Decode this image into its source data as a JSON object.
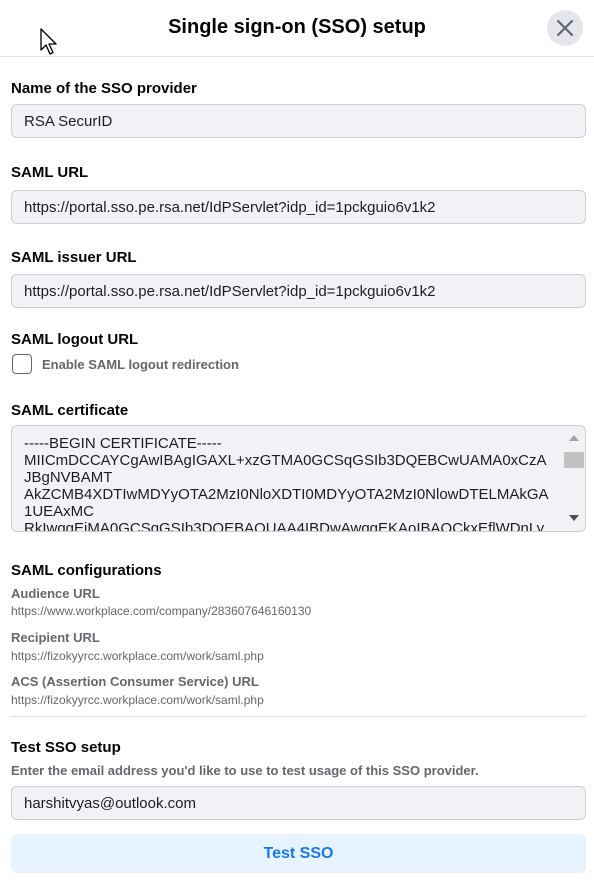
{
  "dialog": {
    "title": "Single sign-on (SSO) setup",
    "close_icon": "close-icon"
  },
  "provider": {
    "label": "Name of the SSO provider",
    "value": "RSA SecurID"
  },
  "saml_url": {
    "label": "SAML URL",
    "value": "https://portal.sso.pe.rsa.net/IdPServlet?idp_id=1pckguio6v1k2"
  },
  "saml_issuer_url": {
    "label": "SAML issuer URL",
    "value": "https://portal.sso.pe.rsa.net/IdPServlet?idp_id=1pckguio6v1k2"
  },
  "saml_logout": {
    "label": "SAML logout URL",
    "checkbox_label": "Enable SAML logout redirection",
    "checked": false
  },
  "certificate": {
    "label": "SAML certificate",
    "value": "-----BEGIN CERTIFICATE-----\nMIICmDCCAYCgAwIBAgIGAXL+xzGTMA0GCSqGSIb3DQEBCwUAMA0xCzA\nJBgNVBAMT\nAkZCMB4XDTIwMDYyOTA2MzI0NloXDTI0MDYyOTA2MzI0NlowDTELMAkGA\n1UEAxMC\nRkIwggEiMA0GCSqGSIb3DQEBAQUAA4IBDwAwggEKAoIBAQCkxEflWDnLy"
  },
  "saml_config": {
    "label": "SAML configurations",
    "audience_label": "Audience URL",
    "audience_value": "https://www.workplace.com/company/283607646160130",
    "recipient_label": "Recipient URL",
    "recipient_value": "https://fizokyyrcc.workplace.com/work/saml.php",
    "acs_label": "ACS (Assertion Consumer Service) URL",
    "acs_value": "https://fizokyyrcc.workplace.com/work/saml.php"
  },
  "test": {
    "label": "Test SSO setup",
    "hint": "Enter the email address you'd like to use to test usage of this SSO provider.",
    "email_value": "harshitvyas@outlook.com",
    "button_label": "Test SSO"
  },
  "colors": {
    "accent": "#1877f2",
    "button_bg": "#e7f3ff",
    "field_bg": "#f0f2f5"
  }
}
